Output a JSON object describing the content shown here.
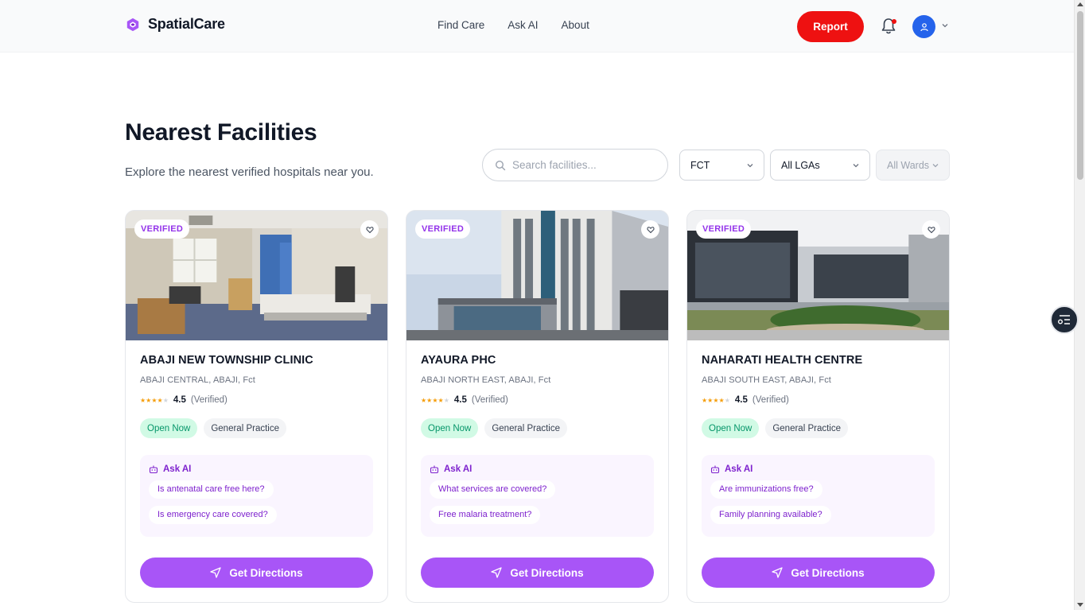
{
  "header": {
    "brand": "SpatialCare",
    "nav": [
      "Find Care",
      "Ask AI",
      "About"
    ],
    "report_label": "Report"
  },
  "page": {
    "title": "Nearest Facilities",
    "subtitle": "Explore the nearest verified hospitals near you."
  },
  "filters": {
    "search_placeholder": "Search facilities...",
    "state": "FCT",
    "lga": "All LGAs",
    "ward": "All Wards"
  },
  "cards": [
    {
      "badge": "VERIFIED",
      "name": "ABAJI NEW TOWNSHIP CLINIC",
      "location": "ABAJI CENTRAL, ABAJI, Fct",
      "rating": "4.5",
      "rating_note": "(Verified)",
      "rating_stars": 4,
      "status": "Open Now",
      "specialty": "General Practice",
      "ask_ai_label": "Ask AI",
      "questions": [
        "Is antenatal care free here?",
        "Is emergency care covered?"
      ],
      "directions_label": "Get Directions"
    },
    {
      "badge": "VERIFIED",
      "name": "AYAURA PHC",
      "location": "ABAJI NORTH EAST, ABAJI, Fct",
      "rating": "4.5",
      "rating_note": "(Verified)",
      "rating_stars": 4,
      "status": "Open Now",
      "specialty": "General Practice",
      "ask_ai_label": "Ask AI",
      "questions": [
        "What services are covered?",
        "Free malaria treatment?"
      ],
      "directions_label": "Get Directions"
    },
    {
      "badge": "VERIFIED",
      "name": "NAHARATI HEALTH CENTRE",
      "location": "ABAJI SOUTH EAST, ABAJI, Fct",
      "rating": "4.5",
      "rating_note": "(Verified)",
      "rating_stars": 4,
      "status": "Open Now",
      "specialty": "General Practice",
      "ask_ai_label": "Ask AI",
      "questions": [
        "Are immunizations free?",
        "Family planning available?"
      ],
      "directions_label": "Get Directions"
    }
  ],
  "icons": {
    "brand": "hexagon-logo-icon",
    "bell": "bell-icon",
    "avatar": "user-icon",
    "search": "search-icon",
    "heart": "heart-icon",
    "ask_ai": "robot-icon",
    "directions": "navigation-arrow-icon",
    "float_widget": "list-settings-icon"
  },
  "colors": {
    "brand_purple": "#a855f7",
    "report_red": "#ee1111",
    "open_green": "#059669",
    "avatar_blue": "#2563eb"
  }
}
